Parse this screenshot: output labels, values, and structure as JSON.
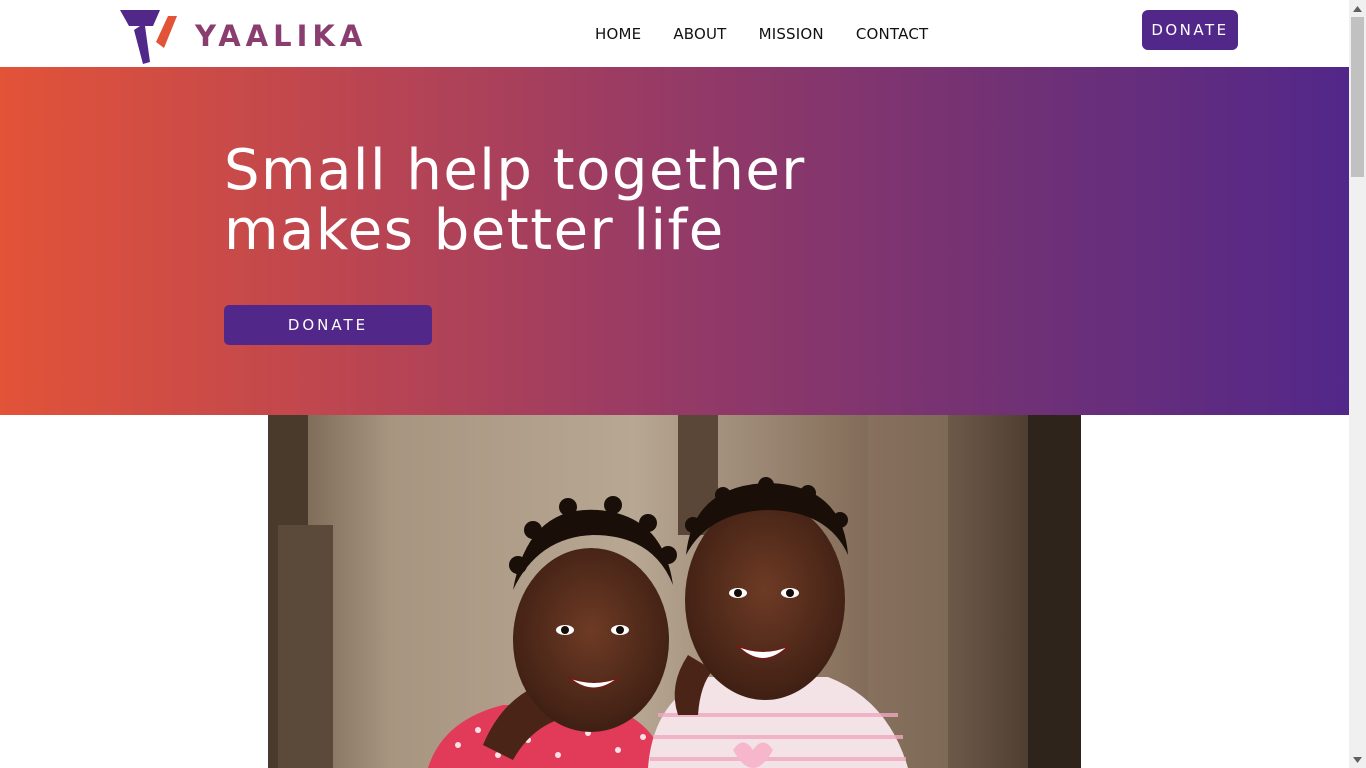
{
  "brand": {
    "name": "YAALIKA",
    "logo_icon": "yaalika-y-logo",
    "colors": {
      "purple": "#52278a",
      "orange": "#e25338",
      "text_mauve": "#8a3d6f"
    }
  },
  "nav": {
    "items": [
      {
        "label": "HOME"
      },
      {
        "label": "ABOUT"
      },
      {
        "label": "MISSION"
      },
      {
        "label": "CONTACT"
      }
    ],
    "donate_label": "DONATE"
  },
  "hero": {
    "title_line1": "Small help together",
    "title_line2": "makes better life",
    "donate_label": "DONATE",
    "gradient": [
      "#e25338",
      "#52278a"
    ]
  },
  "photo": {
    "icon": "photo-two-smiling-children"
  },
  "scrollbar": {
    "up_icon": "scroll-up-arrow-icon",
    "down_icon": "scroll-down-arrow-icon"
  }
}
